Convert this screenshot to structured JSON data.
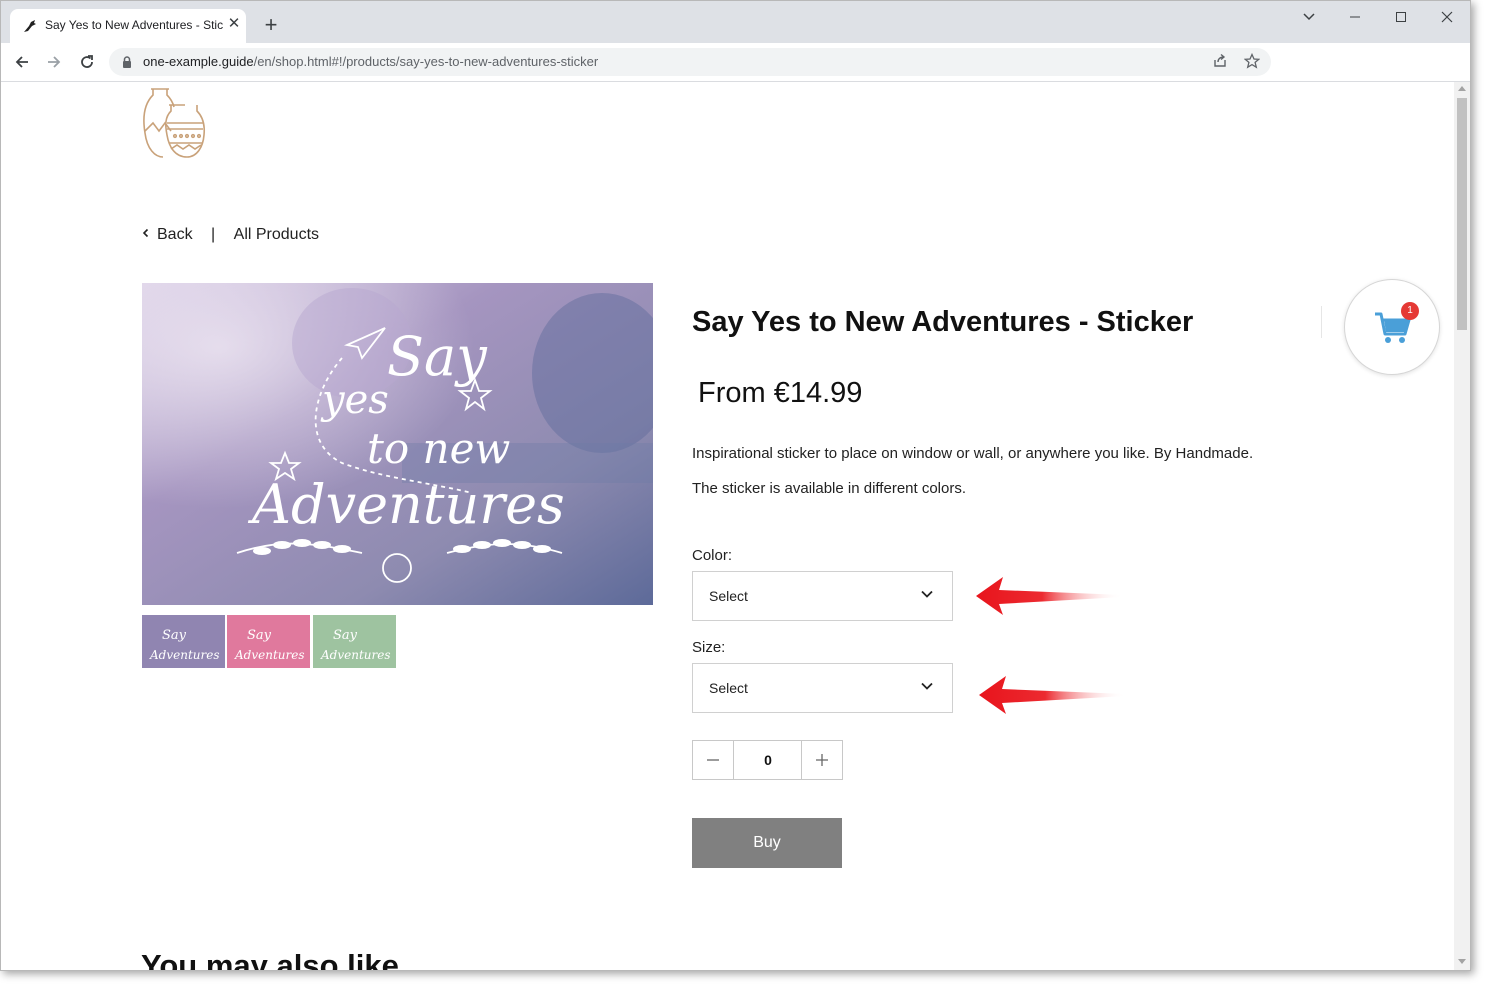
{
  "browser": {
    "tab_title": "Say Yes to New Adventures - Stic",
    "url_host": "one-example.guide",
    "url_path": "/en/shop.html#!/products/say-yes-to-new-adventures-sticker"
  },
  "breadcrumb": {
    "back_label": "Back",
    "separator": "|",
    "all_products_label": "All Products"
  },
  "product": {
    "title": "Say Yes to New Adventures - Sticker",
    "price": "From €14.99",
    "description_1": "Inspirational sticker to place on window or wall, or anywhere you like. By Handmade.",
    "description_2": "The sticker is available in different colors.",
    "image_text": {
      "line1": "Say",
      "line2": "yes",
      "line3": "to new",
      "line4": "Adventures"
    },
    "thumbnails": [
      {
        "name": "purple",
        "color": "#7a6fa0"
      },
      {
        "name": "pink",
        "color": "#d9668e"
      },
      {
        "name": "green",
        "color": "#8cb690"
      }
    ]
  },
  "options": {
    "color_label": "Color:",
    "color_value": "Select",
    "size_label": "Size:",
    "size_value": "Select"
  },
  "quantity": {
    "minus": "−",
    "value": "0",
    "plus": "+"
  },
  "buy_label": "Buy",
  "cart": {
    "count": "1",
    "icon_color": "#4a9fd8"
  },
  "also_like_heading": "You may also like",
  "colors": {
    "annotation_arrow": "#e8141c",
    "buy_button": "#808080"
  }
}
